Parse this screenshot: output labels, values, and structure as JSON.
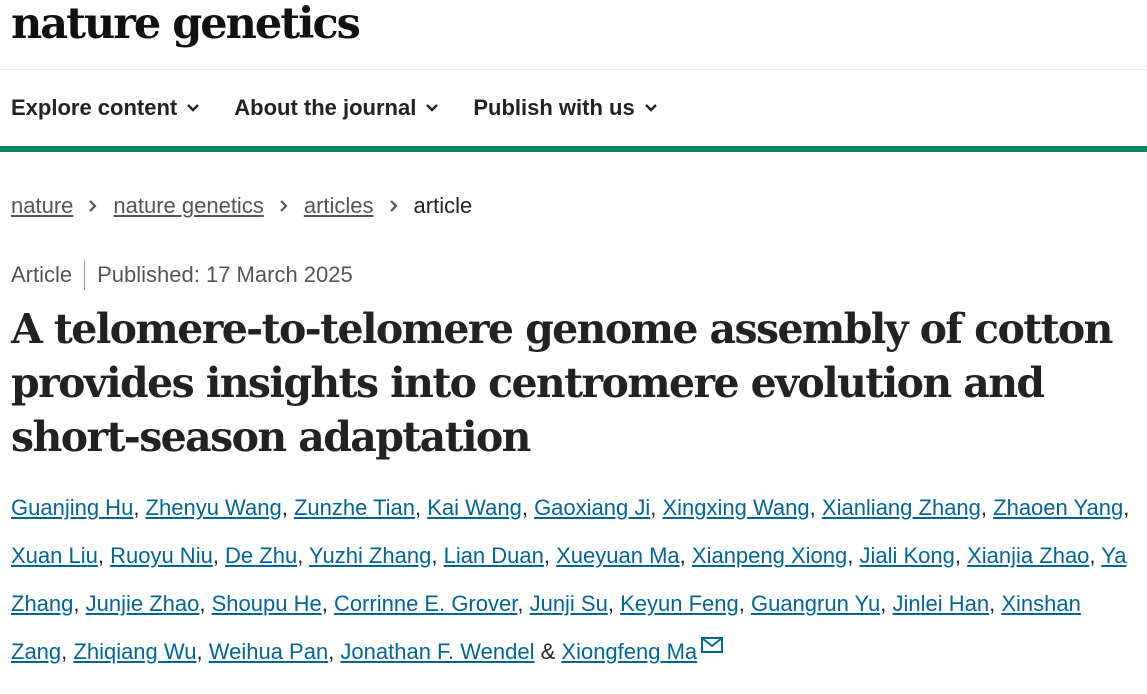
{
  "journal": {
    "logo_text": "nature genetics"
  },
  "nav": {
    "items": [
      {
        "label": "Explore content"
      },
      {
        "label": "About the journal"
      },
      {
        "label": "Publish with us"
      }
    ]
  },
  "breadcrumb": {
    "items": [
      "nature",
      "nature genetics",
      "articles"
    ],
    "current": "article"
  },
  "article": {
    "type": "Article",
    "published": "Published: 17 March 2025",
    "title": "A telomere-to-telomere genome assembly of cotton provides insights into centromere evolution and short-season adaptation",
    "authors": [
      "Guanjing Hu",
      "Zhenyu Wang",
      "Zunzhe Tian",
      "Kai Wang",
      "Gaoxiang Ji",
      "Xingxing Wang",
      "Xianliang Zhang",
      "Zhaoen Yang",
      "Xuan Liu",
      "Ruoyu Niu",
      "De Zhu",
      "Yuzhi Zhang",
      "Lian Duan",
      "Xueyuan Ma",
      "Xianpeng Xiong",
      "Jiali Kong",
      "Xianjia Zhao",
      "Ya Zhang",
      "Junjie Zhao",
      "Shoupu He",
      "Corrinne E. Grover",
      "Junji Su",
      "Keyun Feng",
      "Guangrun Yu",
      "Jinlei Han",
      "Xinshan Zang",
      "Zhiqiang Wu",
      "Weihua Pan",
      "Jonathan F. Wendel",
      "Xiongfeng Ma"
    ],
    "author_separator": ", ",
    "last_author_joiner": " & ",
    "mail_icon": "envelope-icon"
  },
  "colors": {
    "accent": "#058462",
    "link": "#006699",
    "text": "#222222",
    "muted": "#555555"
  }
}
